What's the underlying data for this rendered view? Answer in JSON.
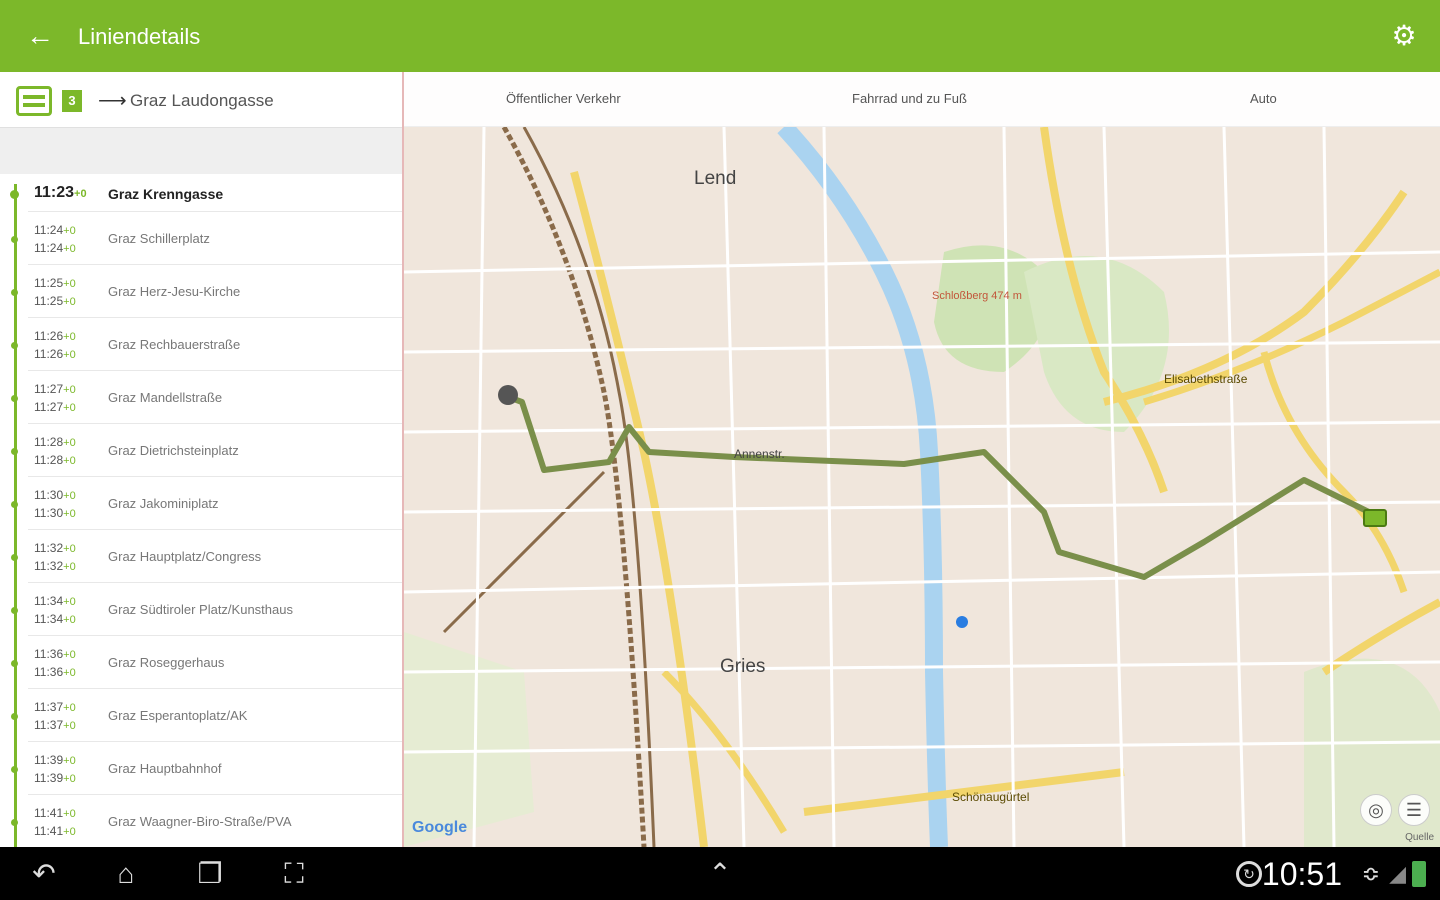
{
  "appbar": {
    "title": "Liniendetails",
    "back_icon": "arrow-left-icon",
    "settings_icon": "gear-icon"
  },
  "route": {
    "line_number": "3",
    "destination": "Graz Laudongasse",
    "vehicle_icon": "tram-icon"
  },
  "stops": [
    {
      "arr": "11:23",
      "arr_delay": "+0",
      "name": "Graz Krenngasse",
      "first": true
    },
    {
      "arr": "11:24",
      "arr_delay": "+0",
      "dep": "11:24",
      "dep_delay": "+0",
      "name": "Graz Schillerplatz"
    },
    {
      "arr": "11:25",
      "arr_delay": "+0",
      "dep": "11:25",
      "dep_delay": "+0",
      "name": "Graz Herz-Jesu-Kirche"
    },
    {
      "arr": "11:26",
      "arr_delay": "+0",
      "dep": "11:26",
      "dep_delay": "+0",
      "name": "Graz Rechbauerstraße"
    },
    {
      "arr": "11:27",
      "arr_delay": "+0",
      "dep": "11:27",
      "dep_delay": "+0",
      "name": "Graz Mandellstraße"
    },
    {
      "arr": "11:28",
      "arr_delay": "+0",
      "dep": "11:28",
      "dep_delay": "+0",
      "name": "Graz Dietrichsteinplatz"
    },
    {
      "arr": "11:30",
      "arr_delay": "+0",
      "dep": "11:30",
      "dep_delay": "+0",
      "name": "Graz Jakominiplatz"
    },
    {
      "arr": "11:32",
      "arr_delay": "+0",
      "dep": "11:32",
      "dep_delay": "+0",
      "name": "Graz Hauptplatz/Congress"
    },
    {
      "arr": "11:34",
      "arr_delay": "+0",
      "dep": "11:34",
      "dep_delay": "+0",
      "name": "Graz Südtiroler Platz/Kunsthaus"
    },
    {
      "arr": "11:36",
      "arr_delay": "+0",
      "dep": "11:36",
      "dep_delay": "+0",
      "name": "Graz Roseggerhaus"
    },
    {
      "arr": "11:37",
      "arr_delay": "+0",
      "dep": "11:37",
      "dep_delay": "+0",
      "name": "Graz Esperantoplatz/AK"
    },
    {
      "arr": "11:39",
      "arr_delay": "+0",
      "dep": "11:39",
      "dep_delay": "+0",
      "name": "Graz Hauptbahnhof"
    },
    {
      "arr": "11:41",
      "arr_delay": "+0",
      "dep": "11:41",
      "dep_delay": "+0",
      "name": "Graz Waagner-Biro-Straße/PVA"
    }
  ],
  "map": {
    "tabs": [
      "Öffentlicher Verkehr",
      "Fahrrad und zu Fuß",
      "Auto"
    ],
    "labels": [
      "Lend",
      "Gries",
      "Schloßberg 474 m",
      "Elisabethstraße",
      "Annenstr.",
      "Schönaugürtel"
    ],
    "provider": "Google",
    "attribution": "Quelle",
    "locate_icon": "locate-icon",
    "layers_icon": "layers-icon",
    "route_color": "#7a8f4a"
  },
  "navbar": {
    "back_icon": "nav-back-icon",
    "home_icon": "home-icon",
    "recents_icon": "recents-icon",
    "screenshot_icon": "screenshot-icon",
    "up_icon": "chevron-up-icon"
  },
  "status": {
    "time": "10:51",
    "sync_icon": "sync-icon",
    "wifi_icon": "wifi-icon",
    "signal_icon": "signal-icon",
    "battery_icon": "battery-icon"
  },
  "colors": {
    "accent": "#7cb82a",
    "navbar": "#000000"
  }
}
